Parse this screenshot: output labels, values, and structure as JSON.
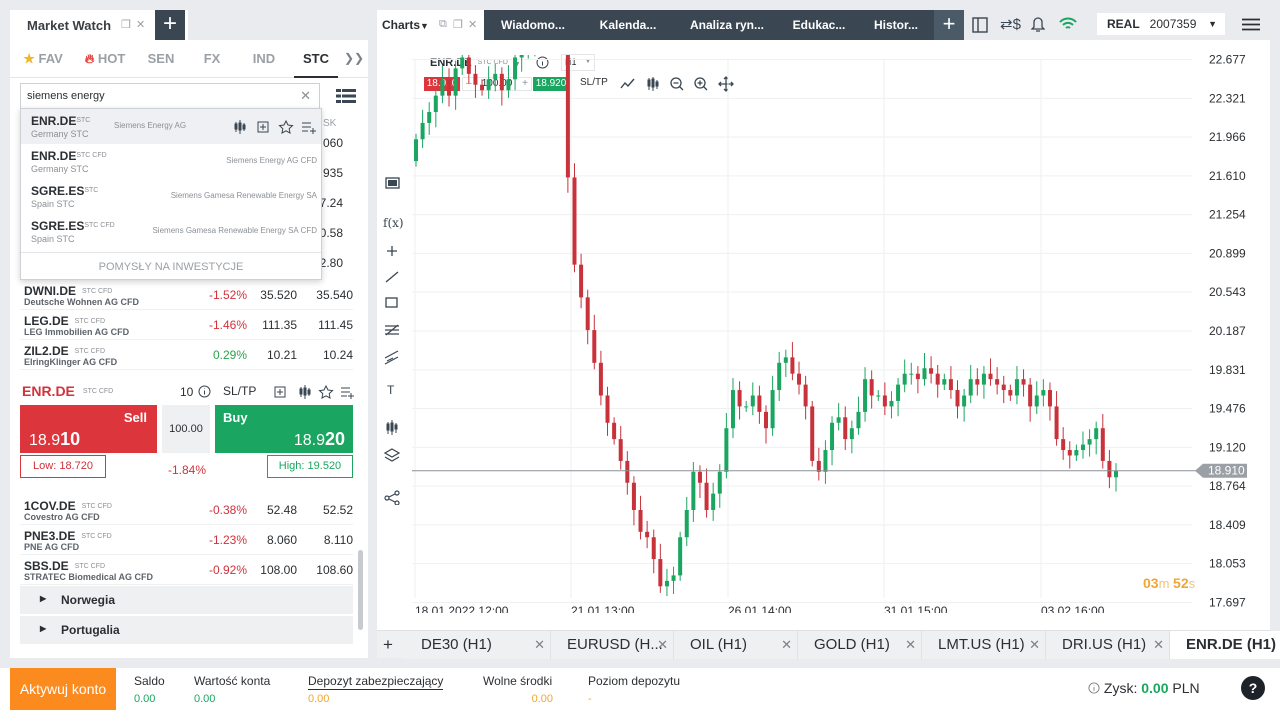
{
  "market_watch": {
    "title": "Market Watch",
    "tabs": [
      {
        "label": "FAV",
        "icon": "star-icon"
      },
      {
        "label": "HOT",
        "icon": "fire-icon"
      },
      {
        "label": "SEN"
      },
      {
        "label": "FX"
      },
      {
        "label": "IND"
      },
      {
        "label": "STC"
      }
    ],
    "active_tab": "STC",
    "search": {
      "value": "siemens energy",
      "results": [
        {
          "symbol": "ENR.DE",
          "type": "STC",
          "market": "Germany STC",
          "desc": "Siemens Energy AG"
        },
        {
          "symbol": "ENR.DE",
          "type": "STC CFD",
          "market": "Germany STC",
          "desc": "Siemens Energy AG CFD"
        },
        {
          "symbol": "SGRE.ES",
          "type": "STC",
          "market": "Spain STC",
          "desc": "Siemens Gamesa Renewable Energy SA"
        },
        {
          "symbol": "SGRE.ES",
          "type": "STC CFD",
          "market": "Spain STC",
          "desc": "Siemens Gamesa Renewable Energy SA CFD"
        }
      ],
      "footer": "POMYSŁY NA INWESTYCJE"
    },
    "column_ask_label": "SK",
    "hidden_asks": [
      "8.060",
      "7.935",
      "7.24",
      "0.58",
      "2.80"
    ],
    "rows_top": [
      {
        "symbol": "DWNI.DE",
        "type": "STC CFD",
        "name": "Deutsche Wohnen AG CFD",
        "change": "-1.52%",
        "bid": "35.520",
        "ask": "35.540",
        "dir": "neg"
      },
      {
        "symbol": "LEG.DE",
        "type": "STC CFD",
        "name": "LEG Immobilien AG CFD",
        "change": "-1.46%",
        "bid": "111.35",
        "ask": "111.45",
        "dir": "neg"
      },
      {
        "symbol": "ZIL2.DE",
        "type": "STC CFD",
        "name": "ElringKlinger AG CFD",
        "change": "0.29%",
        "bid": "10.21",
        "ask": "10.24",
        "dir": "pos"
      }
    ],
    "trade": {
      "symbol": "ENR.DE",
      "type": "STC CFD",
      "qty": "10",
      "sltp": "SL/TP",
      "sell_label": "Sell",
      "sell_price_main": "18.9",
      "sell_price_big": "10",
      "buy_label": "Buy",
      "buy_price_main": "18.9",
      "buy_price_big": "20",
      "volume": "100.00",
      "low": "Low: 18.720",
      "high": "High: 19.520",
      "day_change": "-1.84%"
    },
    "rows_bottom": [
      {
        "symbol": "1COV.DE",
        "type": "STC CFD",
        "name": "Covestro AG CFD",
        "change": "-0.38%",
        "bid": "52.48",
        "ask": "52.52",
        "dir": "neg"
      },
      {
        "symbol": "PNE3.DE",
        "type": "STC CFD",
        "name": "PNE AG CFD",
        "change": "-1.23%",
        "bid": "8.060",
        "ask": "8.110",
        "dir": "neg"
      },
      {
        "symbol": "SBS.DE",
        "type": "STC CFD",
        "name": "STRATEC Biomedical AG CFD",
        "change": "-0.92%",
        "bid": "108.00",
        "ask": "108.60",
        "dir": "neg"
      }
    ],
    "groups": [
      "Norwegia",
      "Portugalia"
    ]
  },
  "top_tabs": {
    "charts": "Charts",
    "items": [
      "Wiadomo...",
      "Kalenda...",
      "Analiza ryn...",
      "Edukac...",
      "Histor..."
    ],
    "account_mode": "REAL",
    "account_id": "2007359"
  },
  "chart": {
    "symbol": "ENR.DE",
    "type": "STC CFD",
    "timeframe": "H1",
    "bid": "18.910",
    "qty": "100.00",
    "ask": "18.920",
    "sltp": "SL/TP",
    "timer_min": "03",
    "timer_sec": "52"
  },
  "chart_data": {
    "type": "candlestick",
    "y_ticks": [
      "22.677",
      "22.321",
      "21.966",
      "21.610",
      "21.254",
      "20.899",
      "20.543",
      "20.187",
      "19.831",
      "19.476",
      "19.120",
      "18.764",
      "18.409",
      "18.053",
      "17.697"
    ],
    "x_ticks": [
      "18.01.2022 12:00",
      "21.01 13:00",
      "26.01 14:00",
      "31.01 15:00",
      "03.02 16:00"
    ],
    "ylim": [
      17.697,
      22.677
    ],
    "current_price": "18.910",
    "current_value": 18.91,
    "close_series": [
      21.95,
      22.1,
      22.2,
      22.35,
      22.5,
      22.35,
      22.6,
      22.7,
      22.55,
      22.45,
      22.4,
      22.5,
      22.55,
      22.4,
      22.5,
      22.7,
      22.75,
      22.8,
      22.85,
      22.9,
      22.95,
      22.9,
      22.85,
      21.6,
      20.8,
      20.5,
      20.2,
      19.9,
      19.6,
      19.35,
      19.2,
      19.0,
      18.8,
      18.55,
      18.35,
      18.3,
      18.1,
      17.85,
      17.9,
      17.95,
      18.3,
      18.55,
      18.9,
      18.8,
      18.55,
      18.7,
      18.9,
      19.3,
      19.65,
      19.5,
      19.5,
      19.6,
      19.45,
      19.3,
      19.65,
      19.9,
      19.95,
      19.8,
      19.7,
      19.5,
      19.0,
      18.9,
      19.1,
      19.35,
      19.4,
      19.2,
      19.3,
      19.45,
      19.75,
      19.6,
      19.6,
      19.5,
      19.55,
      19.7,
      19.8,
      19.8,
      19.75,
      19.85,
      19.8,
      19.7,
      19.75,
      19.65,
      19.5,
      19.6,
      19.75,
      19.7,
      19.8,
      19.75,
      19.7,
      19.65,
      19.6,
      19.75,
      19.7,
      19.5,
      19.6,
      19.65,
      19.5,
      19.2,
      19.1,
      19.05,
      19.1,
      19.15,
      19.2,
      19.3,
      19.0,
      18.85,
      18.91
    ]
  },
  "bottom_tabs": [
    {
      "label": "DE30 (H1)"
    },
    {
      "label": "EURUSD (H..."
    },
    {
      "label": "OIL (H1)"
    },
    {
      "label": "GOLD (H1)"
    },
    {
      "label": "LMT.US (H1)"
    },
    {
      "label": "DRI.US (H1)"
    },
    {
      "label": "ENR.DE (H1)",
      "active": true
    }
  ],
  "footer": {
    "activate": "Aktywuj konto",
    "stats": [
      {
        "label": "Saldo",
        "value": "0.00",
        "color": "green"
      },
      {
        "label": "Wartość konta",
        "value": "0.00",
        "color": "green"
      },
      {
        "label": "Depozyt zabezpieczający",
        "value": "0.00",
        "color": "orange"
      },
      {
        "label": "Wolne środki",
        "value": "0.00",
        "color": "orange"
      },
      {
        "label": "Poziom depozytu",
        "value": "-",
        "color": "orange"
      }
    ],
    "profit_label": "Zysk:",
    "profit_value": "0.00",
    "profit_currency": "PLN",
    "help": "?"
  },
  "colors": {
    "bull": "#1aa660",
    "bear": "#c8323b",
    "accent": "#fc8b1f",
    "dark_bar": "#3a4651"
  }
}
